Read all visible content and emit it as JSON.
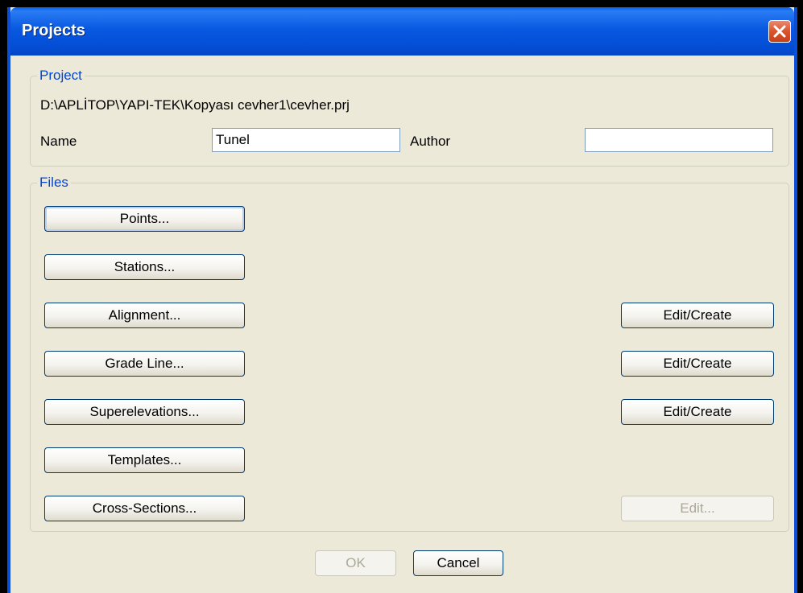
{
  "window": {
    "title": "Projects"
  },
  "project": {
    "group_label": "Project",
    "path": "D:\\APLİTOP\\YAPI-TEK\\Kopyası cevher1\\cevher.prj",
    "name_label": "Name",
    "name_value": "Tunel",
    "author_label": "Author",
    "author_value": ""
  },
  "files": {
    "group_label": "Files",
    "points": "Points...",
    "stations": "Stations...",
    "alignment": "Alignment...",
    "grade_line": "Grade Line...",
    "superelevations": "Superelevations...",
    "templates": "Templates...",
    "cross_sections": "Cross-Sections...",
    "alignment_edit": "Edit/Create",
    "grade_line_edit": "Edit/Create",
    "superelevations_edit": "Edit/Create",
    "cross_sections_edit": "Edit..."
  },
  "footer": {
    "ok": "OK",
    "cancel": "Cancel"
  }
}
